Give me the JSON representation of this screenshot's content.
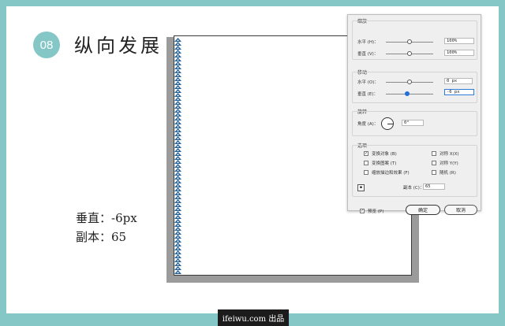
{
  "step": {
    "number": "08",
    "title": "纵向发展"
  },
  "notes": {
    "vertical": "垂直：-6px",
    "copies": "副本：65"
  },
  "dialog": {
    "scale": {
      "label": "缩放",
      "horizontal": {
        "label": "水平 (H)：",
        "value": "100%",
        "knob_pct": 50
      },
      "vertical": {
        "label": "垂直 (V)：",
        "value": "100%",
        "knob_pct": 50
      }
    },
    "move": {
      "label": "移动",
      "horizontal": {
        "label": "水平 (O)：",
        "value": "0 px",
        "knob_pct": 50
      },
      "vertical": {
        "label": "垂直 (E)：",
        "value": "-6 px",
        "knob_pct": 45
      }
    },
    "rotate": {
      "label": "旋转",
      "angle_label": "角度 (A)：",
      "value": "0°"
    },
    "options": {
      "label": "选项",
      "transform_objects": {
        "label": "变换对象 (B)",
        "checked": true
      },
      "transform_patterns": {
        "label": "变换图案 (T)",
        "checked": false
      },
      "scale_strokes": {
        "label": "缩放描边和效果 (F)",
        "checked": false
      },
      "reflect_x": {
        "label": "对称 X(X)",
        "checked": false
      },
      "reflect_y": {
        "label": "对称 Y(Y)",
        "checked": false
      },
      "random": {
        "label": "随机 (R)",
        "checked": false
      }
    },
    "copies": {
      "label": "副本 (C)：",
      "value": "65"
    },
    "preview": {
      "label": "预览 (P)",
      "checked": true
    },
    "ok_label": "确定",
    "cancel_label": "取消"
  },
  "footer": {
    "text": "ifeiwu.com 出品"
  },
  "colors": {
    "accent": "#85c7c7",
    "pattern": "#1f5f9a",
    "slider_active": "#1e6fd9"
  }
}
